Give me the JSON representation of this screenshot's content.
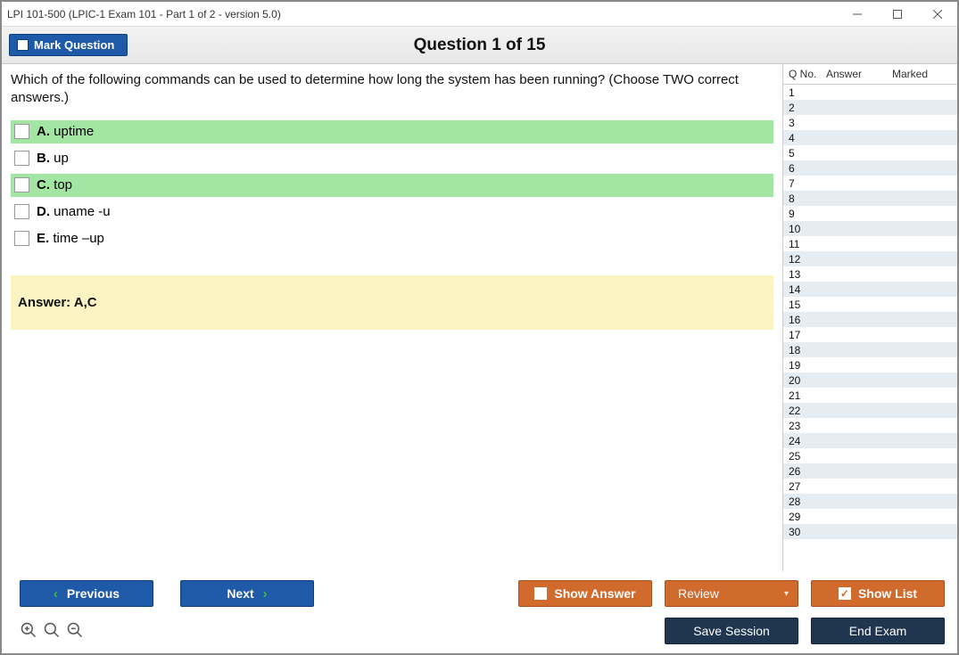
{
  "window": {
    "title": "LPI 101-500 (LPIC-1 Exam 101 - Part 1 of 2 - version 5.0)"
  },
  "toolbar": {
    "mark_label": "Mark Question",
    "question_title": "Question 1 of 15"
  },
  "question": {
    "text": "Which of the following commands can be used to determine how long the system has been running? (Choose TWO correct answers.)",
    "options": [
      {
        "letter": "A.",
        "text": "uptime",
        "highlighted": true
      },
      {
        "letter": "B.",
        "text": "up",
        "highlighted": false
      },
      {
        "letter": "C.",
        "text": "top",
        "highlighted": true
      },
      {
        "letter": "D.",
        "text": "uname -u",
        "highlighted": false
      },
      {
        "letter": "E.",
        "text": "time –up",
        "highlighted": false
      }
    ],
    "answer_label": "Answer: A,C"
  },
  "side": {
    "headers": {
      "qno": "Q No.",
      "answer": "Answer",
      "marked": "Marked"
    },
    "row_count": 30
  },
  "footer": {
    "previous": "Previous",
    "next": "Next",
    "show_answer": "Show Answer",
    "review": "Review",
    "show_list": "Show List",
    "save_session": "Save Session",
    "end_exam": "End Exam"
  }
}
